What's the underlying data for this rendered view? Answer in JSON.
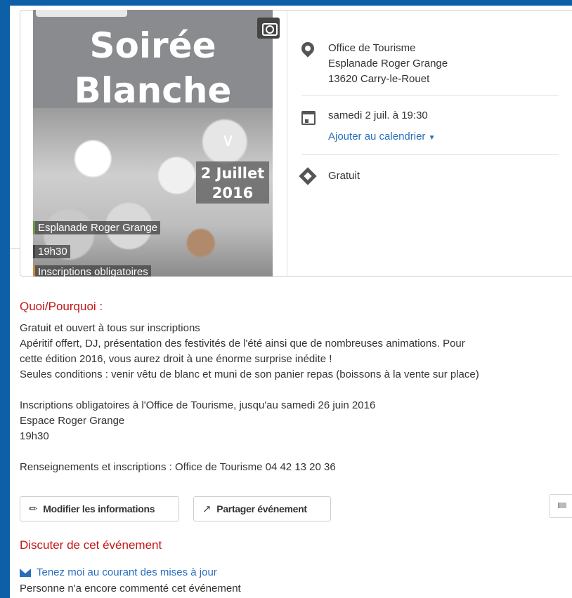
{
  "poster": {
    "title_line1": "Soirée",
    "title_line2": "Blanche",
    "date_line1": "2 Juillet",
    "date_line2": "2016",
    "label_place": "Esplanade Roger Grange",
    "label_time": "19h30",
    "label_inscriptions": "Inscriptions obligatoires"
  },
  "info": {
    "location": {
      "name": "Office de Tourisme",
      "street": "Esplanade Roger Grange",
      "city": "13620 Carry-le-Rouet"
    },
    "datetime": {
      "text": "samedi 2 juil. à 19:30",
      "add_calendar": "Ajouter au calendrier"
    },
    "price": "Gratuit"
  },
  "what": {
    "heading": "Quoi/Pourquoi :",
    "paragraph1": "Gratuit et ouvert à tous sur inscriptions\nApéritif offert, DJ, présentation des festivités de l'été ainsi que de nombreuses animations. Pour\ncette édition 2016, vous aurez droit à une énorme surprise inédite !\nSeules conditions : venir vêtu de blanc et muni de son panier repas (boissons à la vente sur place)",
    "paragraph2": "Inscriptions obligatoires à l'Office de Tourisme, jusqu'au samedi 26 juin 2016\nEspace Roger Grange\n19h30",
    "paragraph3": "Renseignements et inscriptions : Office de Tourisme 04 42 13 20 36"
  },
  "actions": {
    "edit_label": "Modifier les informations",
    "share_label": "Partager événement"
  },
  "discuss": {
    "heading": "Discuter de cet événement",
    "subscribe_link": "Tenez moi au courant des mises à jour",
    "no_comments": "Personne n'a encore commenté cet événement"
  },
  "colors": {
    "frame": "#0d5fa8",
    "heading_red": "#c31616",
    "link_blue": "#2a6ebb"
  }
}
